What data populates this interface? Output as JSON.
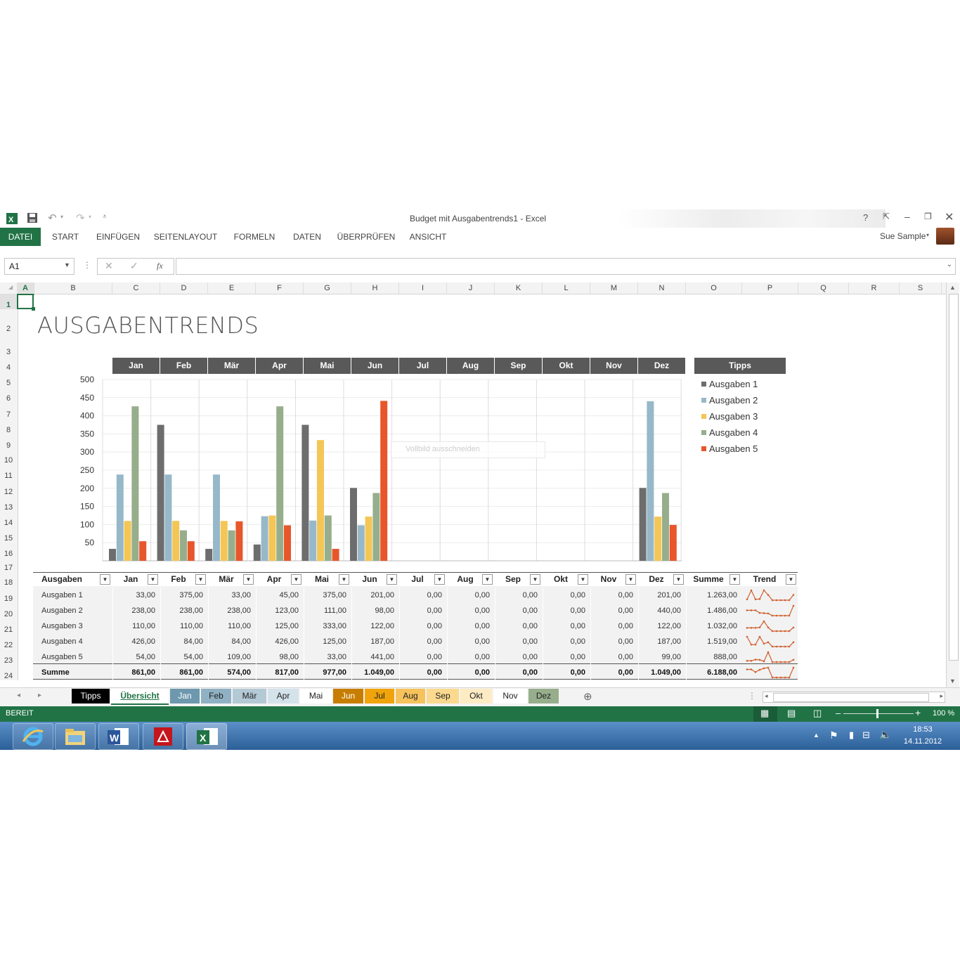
{
  "window": {
    "title": "Budget mit Ausgabentrends1 - Excel",
    "user": "Sue Sample",
    "help": "?"
  },
  "ribbon": {
    "tabs": [
      "DATEI",
      "START",
      "EINFÜGEN",
      "SEITENLAYOUT",
      "FORMELN",
      "DATEN",
      "ÜBERPRÜFEN",
      "ANSICHT"
    ]
  },
  "formula": {
    "name_box": "A1",
    "fx": "fx"
  },
  "columns": [
    "A",
    "B",
    "C",
    "D",
    "E",
    "F",
    "G",
    "H",
    "I",
    "J",
    "K",
    "L",
    "M",
    "N",
    "O",
    "P",
    "Q",
    "R",
    "S"
  ],
  "rows": [
    "1",
    "2",
    "3",
    "4",
    "5",
    "6",
    "7",
    "8",
    "9",
    "10",
    "11",
    "12",
    "13",
    "14",
    "15",
    "16",
    "17",
    "18",
    "19",
    "20",
    "21",
    "22",
    "23",
    "24"
  ],
  "sheet": {
    "title": "AUSGABENTRENDS",
    "tipps_header": "Tipps",
    "tooltip": "Vollbild ausschneiden"
  },
  "chart_data": {
    "type": "bar",
    "categories": [
      "Jan",
      "Feb",
      "Mär",
      "Apr",
      "Mai",
      "Jun",
      "Jul",
      "Aug",
      "Sep",
      "Okt",
      "Nov",
      "Dez"
    ],
    "ylim": [
      0,
      500
    ],
    "yticks": [
      "500",
      "450",
      "400",
      "350",
      "300",
      "250",
      "200",
      "150",
      "100",
      "50"
    ],
    "series": [
      {
        "name": "Ausgaben 1",
        "color": "#6d6d6d",
        "values": [
          33,
          375,
          33,
          45,
          375,
          201,
          0,
          0,
          0,
          0,
          0,
          201
        ]
      },
      {
        "name": "Ausgaben 2",
        "color": "#97b8c9",
        "values": [
          238,
          238,
          238,
          123,
          111,
          98,
          0,
          0,
          0,
          0,
          0,
          440
        ]
      },
      {
        "name": "Ausgaben 3",
        "color": "#f4c656",
        "values": [
          110,
          110,
          110,
          125,
          333,
          122,
          0,
          0,
          0,
          0,
          0,
          122
        ]
      },
      {
        "name": "Ausgaben 4",
        "color": "#97ae8c",
        "values": [
          426,
          84,
          84,
          426,
          125,
          187,
          0,
          0,
          0,
          0,
          0,
          187
        ]
      },
      {
        "name": "Ausgaben 5",
        "color": "#e8562c",
        "values": [
          54,
          54,
          109,
          98,
          33,
          441,
          0,
          0,
          0,
          0,
          0,
          99
        ]
      }
    ]
  },
  "table": {
    "headers": [
      "Ausgaben",
      "Jan",
      "Feb",
      "Mär",
      "Apr",
      "Mai",
      "Jun",
      "Jul",
      "Aug",
      "Sep",
      "Okt",
      "Nov",
      "Dez",
      "Summe",
      "Trend"
    ],
    "rows": [
      [
        "Ausgaben 1",
        "33,00",
        "375,00",
        "33,00",
        "45,00",
        "375,00",
        "201,00",
        "0,00",
        "0,00",
        "0,00",
        "0,00",
        "0,00",
        "201,00",
        "1.263,00"
      ],
      [
        "Ausgaben 2",
        "238,00",
        "238,00",
        "238,00",
        "123,00",
        "111,00",
        "98,00",
        "0,00",
        "0,00",
        "0,00",
        "0,00",
        "0,00",
        "440,00",
        "1.486,00"
      ],
      [
        "Ausgaben 3",
        "110,00",
        "110,00",
        "110,00",
        "125,00",
        "333,00",
        "122,00",
        "0,00",
        "0,00",
        "0,00",
        "0,00",
        "0,00",
        "122,00",
        "1.032,00"
      ],
      [
        "Ausgaben 4",
        "426,00",
        "84,00",
        "84,00",
        "426,00",
        "125,00",
        "187,00",
        "0,00",
        "0,00",
        "0,00",
        "0,00",
        "0,00",
        "187,00",
        "1.519,00"
      ],
      [
        "Ausgaben 5",
        "54,00",
        "54,00",
        "109,00",
        "98,00",
        "33,00",
        "441,00",
        "0,00",
        "0,00",
        "0,00",
        "0,00",
        "0,00",
        "99,00",
        "888,00"
      ],
      [
        "Summe",
        "861,00",
        "861,00",
        "574,00",
        "817,00",
        "977,00",
        "1.049,00",
        "0,00",
        "0,00",
        "0,00",
        "0,00",
        "0,00",
        "1.049,00",
        "6.188,00"
      ]
    ]
  },
  "sheet_tabs": [
    {
      "label": "Tipps",
      "bg": "#000000",
      "fg": "#ffffff"
    },
    {
      "label": "Übersicht",
      "bg": "#ffffff",
      "fg": "#217346"
    },
    {
      "label": "Jan",
      "bg": "#6e98ae",
      "fg": "#ffffff"
    },
    {
      "label": "Feb",
      "bg": "#8fb1c3",
      "fg": "#222222"
    },
    {
      "label": "Mär",
      "bg": "#b3c9d5",
      "fg": "#222222"
    },
    {
      "label": "Apr",
      "bg": "#d4e2ea",
      "fg": "#222222"
    },
    {
      "label": "Mai",
      "bg": "#ffffff",
      "fg": "#222222"
    },
    {
      "label": "Jun",
      "bg": "#c77d00",
      "fg": "#ffffff"
    },
    {
      "label": "Jul",
      "bg": "#f0a30a",
      "fg": "#222222"
    },
    {
      "label": "Aug",
      "bg": "#f6c25c",
      "fg": "#222222"
    },
    {
      "label": "Sep",
      "bg": "#fbd98e",
      "fg": "#222222"
    },
    {
      "label": "Okt",
      "bg": "#fdebc4",
      "fg": "#222222"
    },
    {
      "label": "Nov",
      "bg": "#ffffff",
      "fg": "#222222"
    },
    {
      "label": "Dez",
      "bg": "#97ae8c",
      "fg": "#222222"
    }
  ],
  "status": {
    "ready": "BEREIT",
    "zoom": "100 %"
  },
  "taskbar": {
    "time": "18:53",
    "date": "14.11.2012"
  }
}
